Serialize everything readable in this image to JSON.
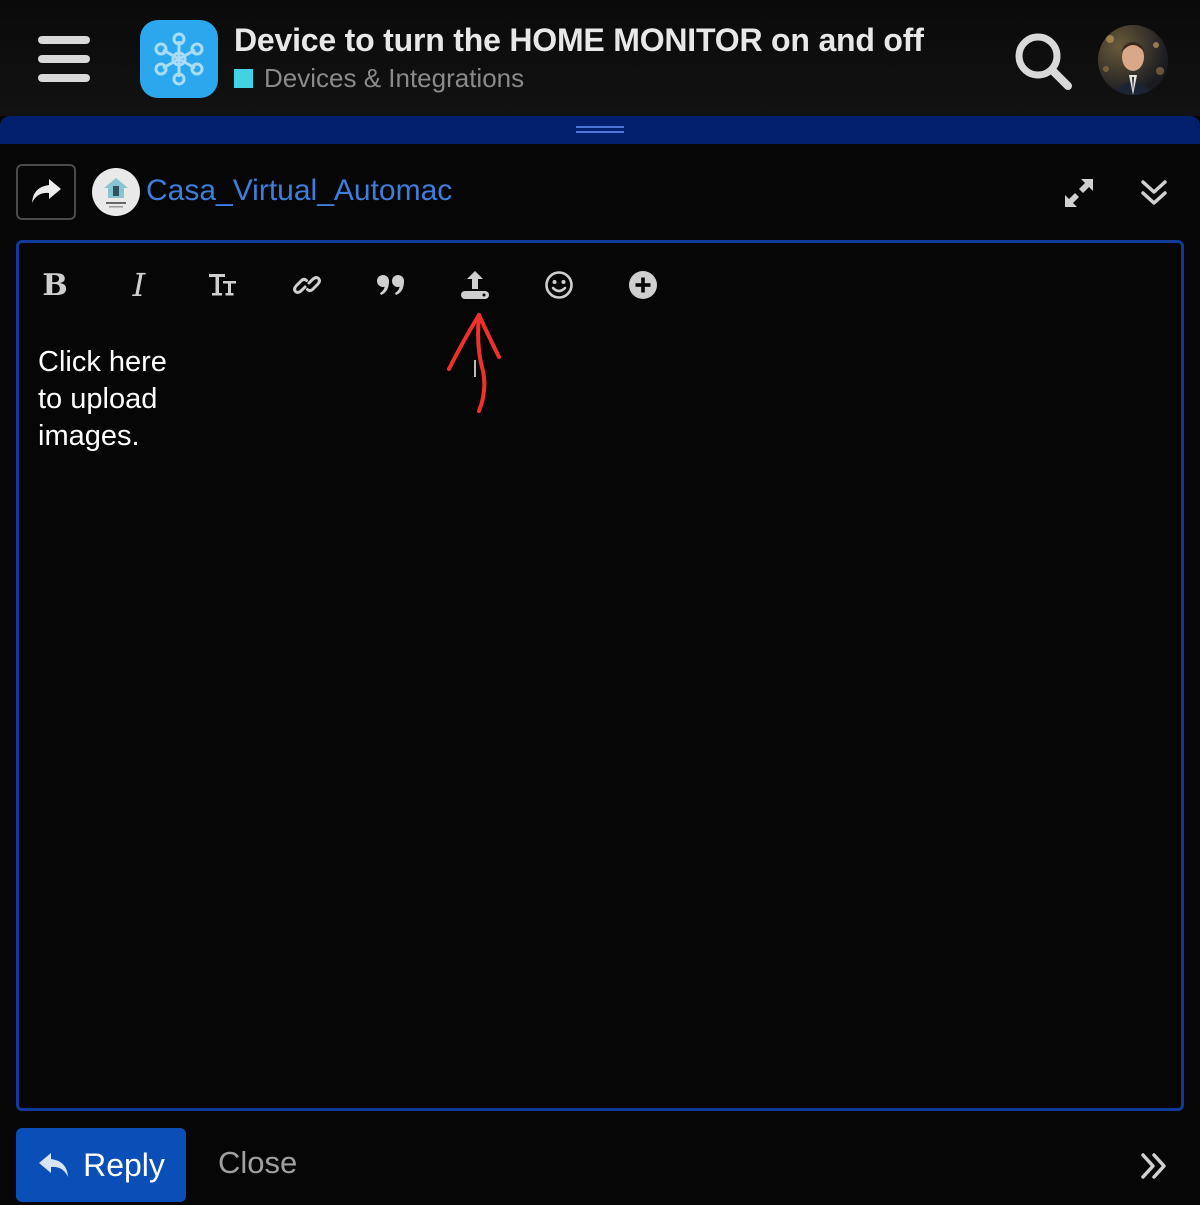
{
  "header": {
    "title": "Device to turn the HOME MONITOR on and off",
    "category": "Devices & Integrations",
    "category_color": "#41d3e4",
    "logo_color": "#2ba7ee",
    "menu_icon": "hamburger-icon",
    "search_icon": "search-icon",
    "avatar_icon": "user-avatar"
  },
  "composer": {
    "reply_type_icon": "share-arrow-icon",
    "username": "Casa_Virtual_Automac",
    "expand_icon": "expand-diagonal-icon",
    "collapse_icon": "chevron-double-down-icon",
    "accent_color": "#0f3a9a"
  },
  "toolbar": {
    "items": [
      {
        "name": "bold",
        "label": "B"
      },
      {
        "name": "italic",
        "label": "I"
      },
      {
        "name": "heading",
        "label": "Tт"
      },
      {
        "name": "link",
        "icon": "link-icon"
      },
      {
        "name": "quote",
        "icon": "quote-icon"
      },
      {
        "name": "upload",
        "icon": "upload-icon"
      },
      {
        "name": "emoji",
        "icon": "emoji-icon"
      },
      {
        "name": "more",
        "icon": "plus-circle-icon"
      }
    ]
  },
  "editor": {
    "content": "Click here\nto upload\nimages.",
    "annotation": "red-arrow-pointing-to-upload"
  },
  "footer": {
    "reply_label": "Reply",
    "close_label": "Close",
    "reply_color": "#0a4fb8",
    "more_icon": "chevron-double-right-icon"
  }
}
